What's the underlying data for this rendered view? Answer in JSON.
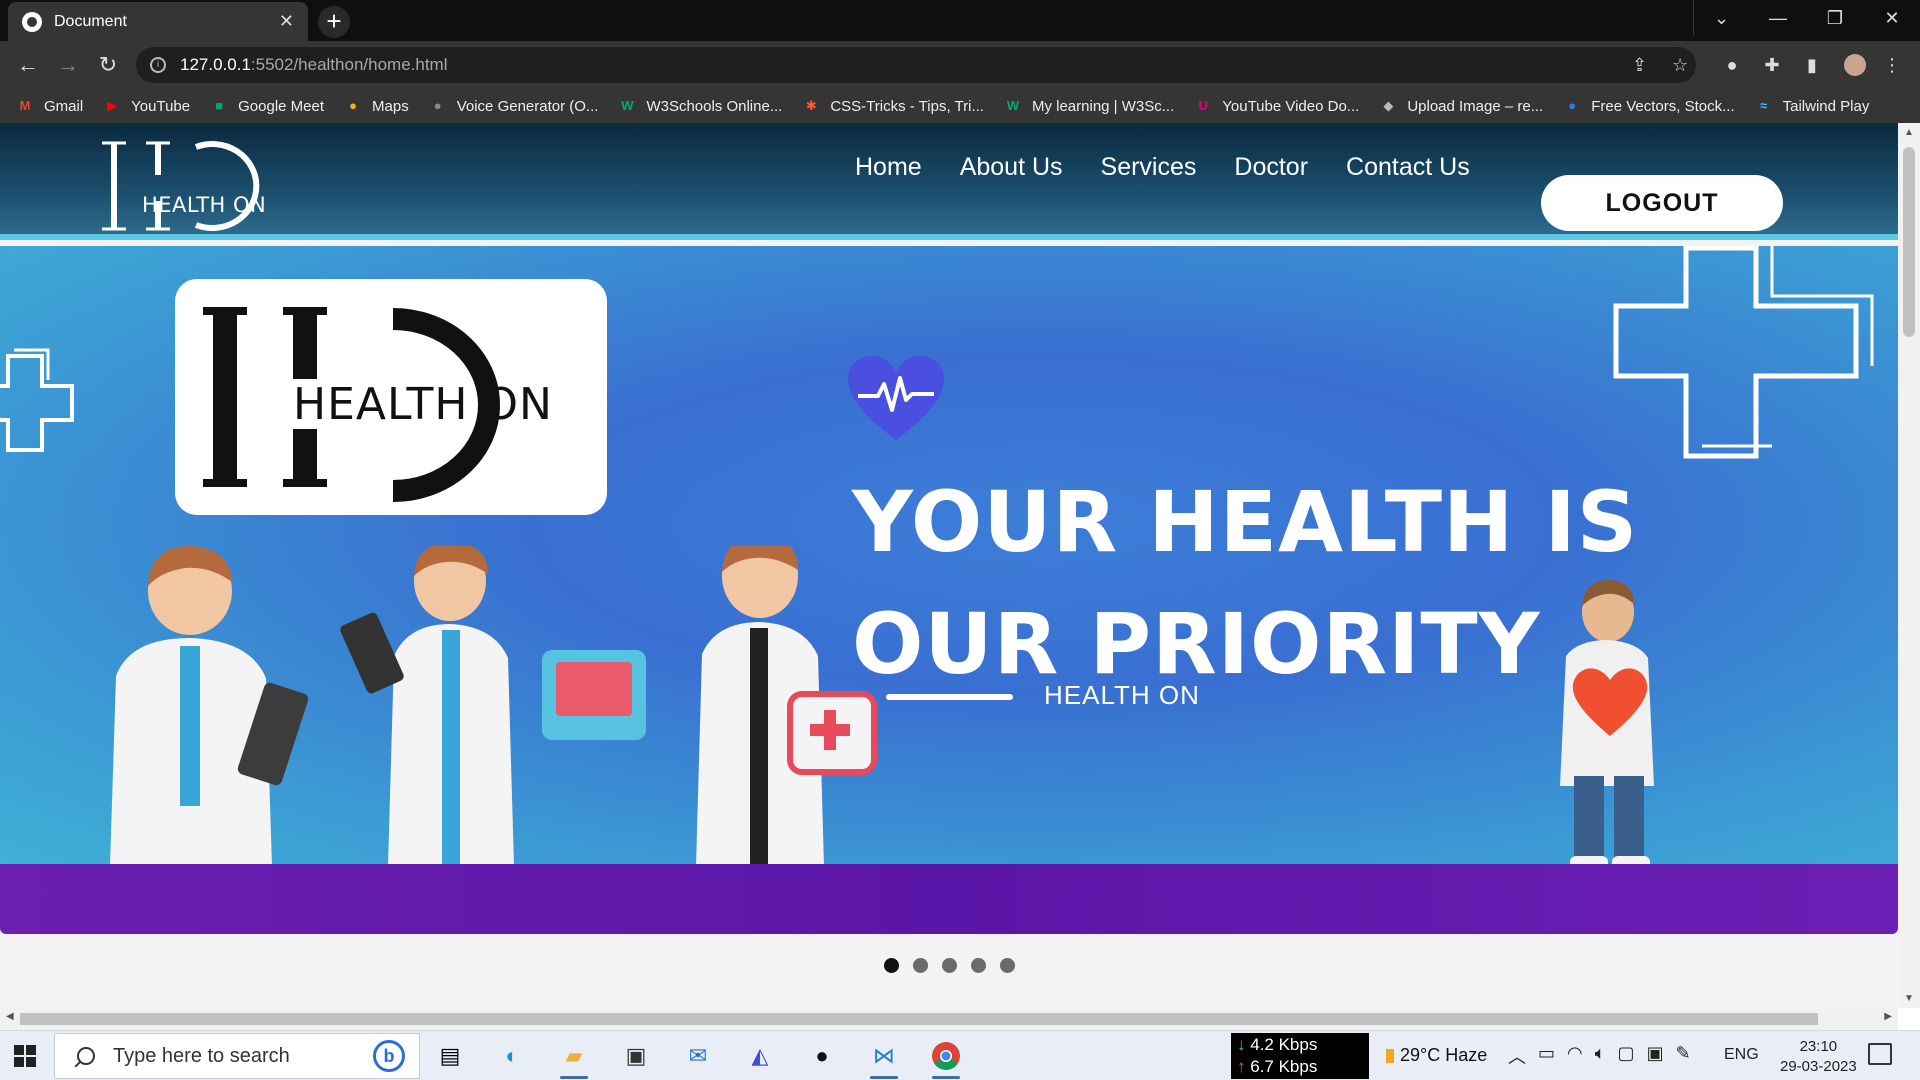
{
  "browser": {
    "tab_title": "Document",
    "tab_close": "✕",
    "new_tab": "+",
    "url_host": "127.0.0.1",
    "url_rest": ":5502/healthon/home.html"
  },
  "bookmarks": [
    {
      "label": "Gmail",
      "icon": "M",
      "color": "#ea4335"
    },
    {
      "label": "YouTube",
      "icon": "▶",
      "color": "#ff0000"
    },
    {
      "label": "Google Meet",
      "icon": "■",
      "color": "#00a86b"
    },
    {
      "label": "Maps",
      "icon": "●",
      "color": "#f4b400"
    },
    {
      "label": "Voice Generator (O...",
      "icon": "●",
      "color": "#888888"
    },
    {
      "label": "W3Schools Online...",
      "icon": "W",
      "color": "#04aa6d"
    },
    {
      "label": "CSS-Tricks - Tips, Tri...",
      "icon": "✱",
      "color": "#ff5c2a"
    },
    {
      "label": "My learning | W3Sc...",
      "icon": "W",
      "color": "#04aa6d"
    },
    {
      "label": "YouTube Video Do...",
      "icon": "U",
      "color": "#e3007b"
    },
    {
      "label": "Upload Image – re...",
      "icon": "◆",
      "color": "#bbbbbb"
    },
    {
      "label": "Free Vectors, Stock...",
      "icon": "●",
      "color": "#2a7de1"
    },
    {
      "label": "Tailwind Play",
      "icon": "≈",
      "color": "#38bdf8"
    }
  ],
  "site": {
    "logo_text": "HEALTH ON",
    "nav": [
      "Home",
      "About Us",
      "Services",
      "Doctor",
      "Contact Us"
    ],
    "logout": "LOGOUT"
  },
  "hero": {
    "logo_text": "HEALTH ON",
    "title_line1": "YOUR HEALTH IS",
    "title_line2": "OUR PRIORITY",
    "subtitle": "HEALTH ON",
    "slides": 5,
    "active_slide": 1
  },
  "taskbar": {
    "search_placeholder": "Type here to search",
    "net_down": "4.2 Kbps",
    "net_up": "6.7 Kbps",
    "weather": "29°C  Haze",
    "lang": "ENG",
    "time": "23:10",
    "date": "29-03-2023"
  },
  "colors": {
    "header_accent": "#5bc8e6",
    "hero_blue": "#3a6fd2",
    "hero_purple": "#5a16a8"
  }
}
